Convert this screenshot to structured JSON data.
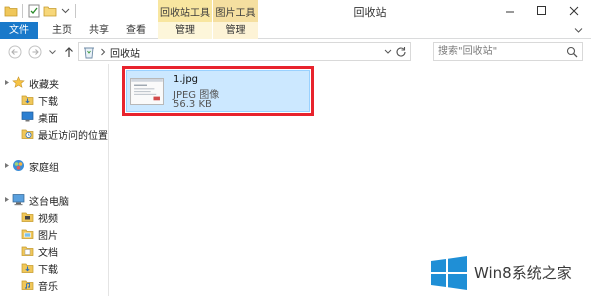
{
  "titlebar": {
    "window_title": "回收站",
    "context_groups": [
      "回收站工具",
      "图片工具"
    ]
  },
  "ribbon": {
    "tabs": [
      "文件",
      "主页",
      "共享",
      "查看",
      "管理",
      "管理"
    ]
  },
  "nav": {
    "address_path": "回收站",
    "search_placeholder": "搜索\"回收站\""
  },
  "sidebar": {
    "items": [
      {
        "label": "收藏夹",
        "icon": "star-icon"
      },
      {
        "label": "下载",
        "icon": "downloads-folder-icon"
      },
      {
        "label": "桌面",
        "icon": "desktop-icon"
      },
      {
        "label": "最近访问的位置",
        "icon": "recent-places-icon"
      },
      {
        "label": "家庭组",
        "icon": "homegroup-icon"
      },
      {
        "label": "这台电脑",
        "icon": "computer-icon"
      },
      {
        "label": "视频",
        "icon": "videos-folder-icon"
      },
      {
        "label": "图片",
        "icon": "pictures-folder-icon"
      },
      {
        "label": "文档",
        "icon": "documents-folder-icon"
      },
      {
        "label": "下载",
        "icon": "downloads-folder-icon"
      },
      {
        "label": "音乐",
        "icon": "music-folder-icon"
      }
    ]
  },
  "files": [
    {
      "name": "1.jpg",
      "type": "JPEG 图像",
      "size": "56.3 KB"
    }
  ],
  "watermark": {
    "text": "Win8系统之家"
  },
  "colors": {
    "file_tab": "#1979ca",
    "selection": "#cce8ff",
    "highlight_border": "#e8232d",
    "win_logo": "#1f8fd6"
  }
}
